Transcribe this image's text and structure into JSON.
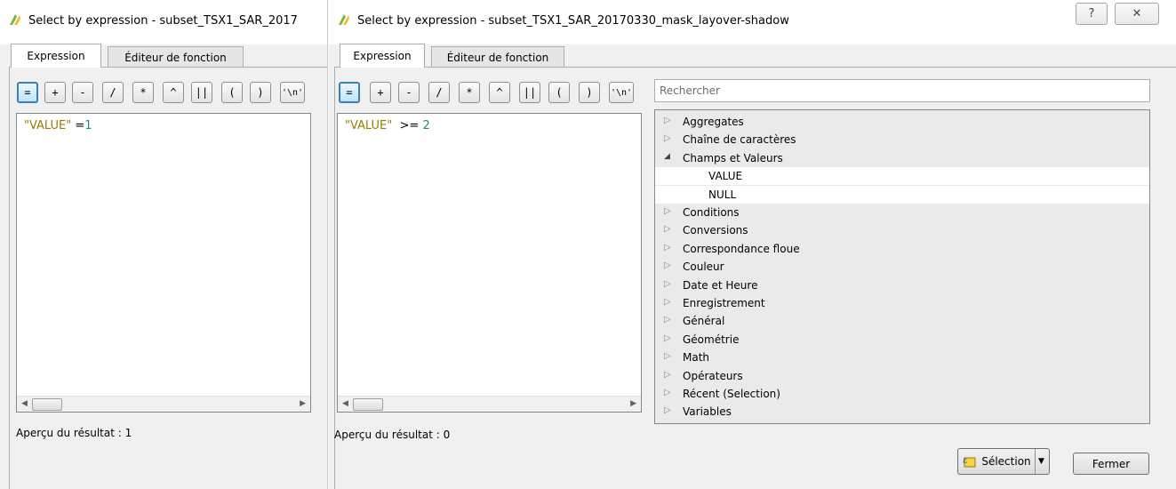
{
  "window_left": {
    "title": "Select by expression - subset_TSX1_SAR_2017",
    "tabs": [
      "Expression",
      "Éditeur de fonction"
    ],
    "operators": [
      "=",
      "+",
      "-",
      "/",
      "*",
      "^",
      "||",
      "(",
      ")",
      "'\\n'"
    ],
    "expression": {
      "field": "\"VALUE\"",
      "operator": " =",
      "value": "1"
    },
    "preview_label": "Aperçu du résultat :",
    "preview_value": "1"
  },
  "window_right": {
    "title": "Select by expression - subset_TSX1_SAR_20170330_mask_layover-shadow",
    "help_button": "?",
    "close_button": "✕",
    "tabs": [
      "Expression",
      "Éditeur de fonction"
    ],
    "operators": [
      "=",
      "+",
      "-",
      "/",
      "*",
      "^",
      "||",
      "(",
      ")",
      "'\\n'"
    ],
    "expression": {
      "field": "\"VALUE\"",
      "operator": "  >= ",
      "value": "2"
    },
    "preview_label": "Aperçu du résultat :",
    "preview_value": "0",
    "search_placeholder": "Rechercher",
    "tree": [
      {
        "label": "Aggregates",
        "expanded": false,
        "level": 0
      },
      {
        "label": "Chaîne de caractères",
        "expanded": false,
        "level": 0
      },
      {
        "label": "Champs et Valeurs",
        "expanded": true,
        "level": 0
      },
      {
        "label": "VALUE",
        "level": 1
      },
      {
        "label": "NULL",
        "level": 1
      },
      {
        "label": "Conditions",
        "expanded": false,
        "level": 0
      },
      {
        "label": "Conversions",
        "expanded": false,
        "level": 0
      },
      {
        "label": "Correspondance floue",
        "expanded": false,
        "level": 0
      },
      {
        "label": "Couleur",
        "expanded": false,
        "level": 0
      },
      {
        "label": "Date et Heure",
        "expanded": false,
        "level": 0
      },
      {
        "label": "Enregistrement",
        "expanded": false,
        "level": 0
      },
      {
        "label": "Général",
        "expanded": false,
        "level": 0
      },
      {
        "label": "Géométrie",
        "expanded": false,
        "level": 0
      },
      {
        "label": "Math",
        "expanded": false,
        "level": 0
      },
      {
        "label": "Opérateurs",
        "expanded": false,
        "level": 0
      },
      {
        "label": "Récent (Selection)",
        "expanded": false,
        "level": 0
      },
      {
        "label": "Variables",
        "expanded": false,
        "level": 0
      }
    ],
    "selection_button": "Sélection",
    "close_dialog_button": "Fermer"
  },
  "colors": {
    "field": "#9a7b00",
    "number": "#1a8c8c",
    "accent": "#3c7fb1"
  },
  "icons": {
    "app": "qgis-icon",
    "selection": "select-by-expression-icon"
  }
}
